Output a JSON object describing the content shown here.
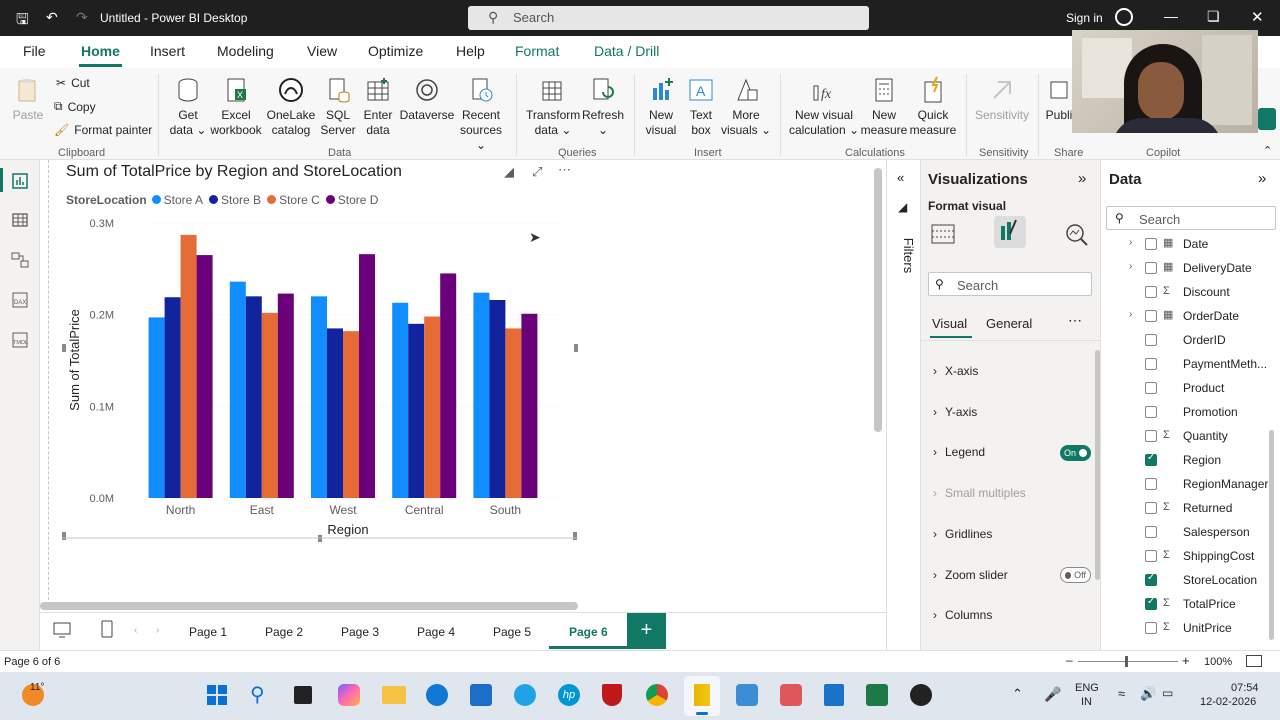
{
  "titlebar": {
    "title": "Untitled - Power BI Desktop",
    "search_placeholder": "Search",
    "sign_in": "Sign in"
  },
  "tabs": {
    "file": "File",
    "home": "Home",
    "insert": "Insert",
    "modeling": "Modeling",
    "view": "View",
    "optimize": "Optimize",
    "help": "Help",
    "format": "Format",
    "data_drill": "Data / Drill"
  },
  "ribbon": {
    "paste": "Paste",
    "cut": "Cut",
    "copy": "Copy",
    "format_painter": "Format painter",
    "get_data": "Get data",
    "excel_workbook": "Excel workbook",
    "onelake_catalog": "OneLake catalog",
    "sql_server": "SQL Server",
    "enter_data": "Enter data",
    "dataverse": "Dataverse",
    "recent_sources": "Recent sources",
    "transform_data": "Transform data",
    "refresh": "Refresh",
    "new_visual": "New visual",
    "text_box": "Text box",
    "more_visuals": "More visuals",
    "new_visual_calculation": "New visual calculation",
    "new_measure": "New measure",
    "quick_measure": "Quick measure",
    "sensitivity": "Sensitivity",
    "publish": "Publi",
    "groups": {
      "clipboard": "Clipboard",
      "data": "Data",
      "queries": "Queries",
      "insert": "Insert",
      "calculations": "Calculations",
      "sensitivity": "Sensitivity",
      "share": "Share",
      "copilot": "Copilot"
    }
  },
  "chart_data": {
    "type": "bar",
    "title": "Sum of TotalPrice by Region and StoreLocation",
    "legend_title": "StoreLocation",
    "xlabel": "Region",
    "ylabel": "Sum of TotalPrice",
    "categories": [
      "North",
      "East",
      "West",
      "Central",
      "South"
    ],
    "ylim": [
      0,
      0.3
    ],
    "yticks": [
      "0.0M",
      "0.1M",
      "0.2M",
      "0.3M"
    ],
    "series": [
      {
        "name": "Store A",
        "color": "#118DFF",
        "values": [
          0.197,
          0.236,
          0.22,
          0.213,
          0.224
        ]
      },
      {
        "name": "Store B",
        "color": "#12239E",
        "values": [
          0.219,
          0.22,
          0.185,
          0.19,
          0.216
        ]
      },
      {
        "name": "Store C",
        "color": "#E66C37",
        "values": [
          0.287,
          0.202,
          0.182,
          0.198,
          0.185
        ]
      },
      {
        "name": "Store D",
        "color": "#6B007B",
        "values": [
          0.265,
          0.223,
          0.266,
          0.245,
          0.201
        ]
      }
    ],
    "legend_position": "top-left",
    "grid": true
  },
  "filters": {
    "label": "Filters"
  },
  "viz_pane": {
    "title": "Visualizations",
    "format_visual": "Format visual",
    "search_placeholder": "Search",
    "tabs": {
      "visual": "Visual",
      "general": "General"
    },
    "sections": [
      {
        "label": "X-axis"
      },
      {
        "label": "Y-axis"
      },
      {
        "label": "Legend",
        "toggle": "On"
      },
      {
        "label": "Small multiples"
      },
      {
        "label": "Gridlines"
      },
      {
        "label": "Zoom slider",
        "toggle": "Off"
      },
      {
        "label": "Columns"
      }
    ]
  },
  "data_pane": {
    "title": "Data",
    "search_placeholder": "Search",
    "fields": [
      {
        "name": "Date",
        "icon": "calendar-icon",
        "checked": false
      },
      {
        "name": "DeliveryDate",
        "icon": "calendar-icon",
        "checked": false
      },
      {
        "name": "Discount",
        "icon": "sigma-icon",
        "checked": false
      },
      {
        "name": "OrderDate",
        "icon": "calendar-icon",
        "checked": false
      },
      {
        "name": "OrderID",
        "icon": "",
        "checked": false
      },
      {
        "name": "PaymentMeth...",
        "icon": "",
        "checked": false
      },
      {
        "name": "Product",
        "icon": "",
        "checked": false
      },
      {
        "name": "Promotion",
        "icon": "",
        "checked": false
      },
      {
        "name": "Quantity",
        "icon": "sigma-icon",
        "checked": false
      },
      {
        "name": "Region",
        "icon": "",
        "checked": true
      },
      {
        "name": "RegionManager",
        "icon": "",
        "checked": false
      },
      {
        "name": "Returned",
        "icon": "sigma-icon",
        "checked": false
      },
      {
        "name": "Salesperson",
        "icon": "",
        "checked": false
      },
      {
        "name": "ShippingCost",
        "icon": "sigma-icon",
        "checked": false
      },
      {
        "name": "StoreLocation",
        "icon": "",
        "checked": true
      },
      {
        "name": "TotalPrice",
        "icon": "sigma-icon",
        "checked": true
      },
      {
        "name": "UnitPrice",
        "icon": "sigma-icon",
        "checked": false
      }
    ]
  },
  "pages": [
    "Page 1",
    "Page 2",
    "Page 3",
    "Page 4",
    "Page 5",
    "Page 6"
  ],
  "status": {
    "page_info": "Page 6 of 6",
    "zoom": "100%"
  },
  "taskbar": {
    "weather": "11°",
    "lang1": "ENG",
    "lang2": "IN",
    "time": "07:54",
    "date": "12-02-2026"
  }
}
